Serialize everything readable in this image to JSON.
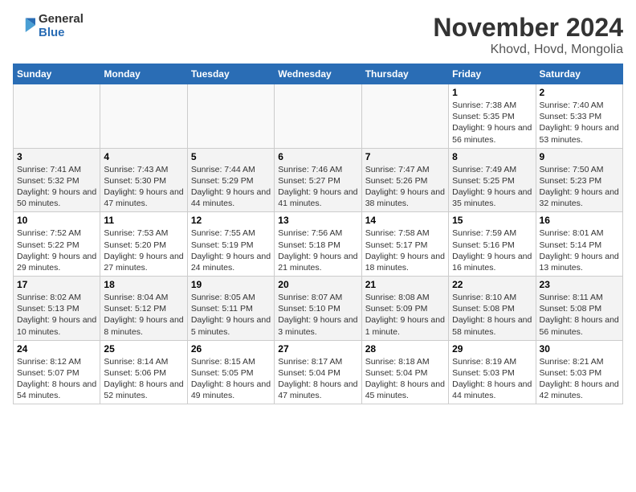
{
  "header": {
    "logo_line1": "General",
    "logo_line2": "Blue",
    "title": "November 2024",
    "subtitle": "Khovd, Hovd, Mongolia"
  },
  "weekdays": [
    "Sunday",
    "Monday",
    "Tuesday",
    "Wednesday",
    "Thursday",
    "Friday",
    "Saturday"
  ],
  "weeks": [
    [
      {
        "day": "",
        "info": ""
      },
      {
        "day": "",
        "info": ""
      },
      {
        "day": "",
        "info": ""
      },
      {
        "day": "",
        "info": ""
      },
      {
        "day": "",
        "info": ""
      },
      {
        "day": "1",
        "info": "Sunrise: 7:38 AM\nSunset: 5:35 PM\nDaylight: 9 hours and 56 minutes."
      },
      {
        "day": "2",
        "info": "Sunrise: 7:40 AM\nSunset: 5:33 PM\nDaylight: 9 hours and 53 minutes."
      }
    ],
    [
      {
        "day": "3",
        "info": "Sunrise: 7:41 AM\nSunset: 5:32 PM\nDaylight: 9 hours and 50 minutes."
      },
      {
        "day": "4",
        "info": "Sunrise: 7:43 AM\nSunset: 5:30 PM\nDaylight: 9 hours and 47 minutes."
      },
      {
        "day": "5",
        "info": "Sunrise: 7:44 AM\nSunset: 5:29 PM\nDaylight: 9 hours and 44 minutes."
      },
      {
        "day": "6",
        "info": "Sunrise: 7:46 AM\nSunset: 5:27 PM\nDaylight: 9 hours and 41 minutes."
      },
      {
        "day": "7",
        "info": "Sunrise: 7:47 AM\nSunset: 5:26 PM\nDaylight: 9 hours and 38 minutes."
      },
      {
        "day": "8",
        "info": "Sunrise: 7:49 AM\nSunset: 5:25 PM\nDaylight: 9 hours and 35 minutes."
      },
      {
        "day": "9",
        "info": "Sunrise: 7:50 AM\nSunset: 5:23 PM\nDaylight: 9 hours and 32 minutes."
      }
    ],
    [
      {
        "day": "10",
        "info": "Sunrise: 7:52 AM\nSunset: 5:22 PM\nDaylight: 9 hours and 29 minutes."
      },
      {
        "day": "11",
        "info": "Sunrise: 7:53 AM\nSunset: 5:20 PM\nDaylight: 9 hours and 27 minutes."
      },
      {
        "day": "12",
        "info": "Sunrise: 7:55 AM\nSunset: 5:19 PM\nDaylight: 9 hours and 24 minutes."
      },
      {
        "day": "13",
        "info": "Sunrise: 7:56 AM\nSunset: 5:18 PM\nDaylight: 9 hours and 21 minutes."
      },
      {
        "day": "14",
        "info": "Sunrise: 7:58 AM\nSunset: 5:17 PM\nDaylight: 9 hours and 18 minutes."
      },
      {
        "day": "15",
        "info": "Sunrise: 7:59 AM\nSunset: 5:16 PM\nDaylight: 9 hours and 16 minutes."
      },
      {
        "day": "16",
        "info": "Sunrise: 8:01 AM\nSunset: 5:14 PM\nDaylight: 9 hours and 13 minutes."
      }
    ],
    [
      {
        "day": "17",
        "info": "Sunrise: 8:02 AM\nSunset: 5:13 PM\nDaylight: 9 hours and 10 minutes."
      },
      {
        "day": "18",
        "info": "Sunrise: 8:04 AM\nSunset: 5:12 PM\nDaylight: 9 hours and 8 minutes."
      },
      {
        "day": "19",
        "info": "Sunrise: 8:05 AM\nSunset: 5:11 PM\nDaylight: 9 hours and 5 minutes."
      },
      {
        "day": "20",
        "info": "Sunrise: 8:07 AM\nSunset: 5:10 PM\nDaylight: 9 hours and 3 minutes."
      },
      {
        "day": "21",
        "info": "Sunrise: 8:08 AM\nSunset: 5:09 PM\nDaylight: 9 hours and 1 minute."
      },
      {
        "day": "22",
        "info": "Sunrise: 8:10 AM\nSunset: 5:08 PM\nDaylight: 8 hours and 58 minutes."
      },
      {
        "day": "23",
        "info": "Sunrise: 8:11 AM\nSunset: 5:08 PM\nDaylight: 8 hours and 56 minutes."
      }
    ],
    [
      {
        "day": "24",
        "info": "Sunrise: 8:12 AM\nSunset: 5:07 PM\nDaylight: 8 hours and 54 minutes."
      },
      {
        "day": "25",
        "info": "Sunrise: 8:14 AM\nSunset: 5:06 PM\nDaylight: 8 hours and 52 minutes."
      },
      {
        "day": "26",
        "info": "Sunrise: 8:15 AM\nSunset: 5:05 PM\nDaylight: 8 hours and 49 minutes."
      },
      {
        "day": "27",
        "info": "Sunrise: 8:17 AM\nSunset: 5:04 PM\nDaylight: 8 hours and 47 minutes."
      },
      {
        "day": "28",
        "info": "Sunrise: 8:18 AM\nSunset: 5:04 PM\nDaylight: 8 hours and 45 minutes."
      },
      {
        "day": "29",
        "info": "Sunrise: 8:19 AM\nSunset: 5:03 PM\nDaylight: 8 hours and 44 minutes."
      },
      {
        "day": "30",
        "info": "Sunrise: 8:21 AM\nSunset: 5:03 PM\nDaylight: 8 hours and 42 minutes."
      }
    ]
  ]
}
